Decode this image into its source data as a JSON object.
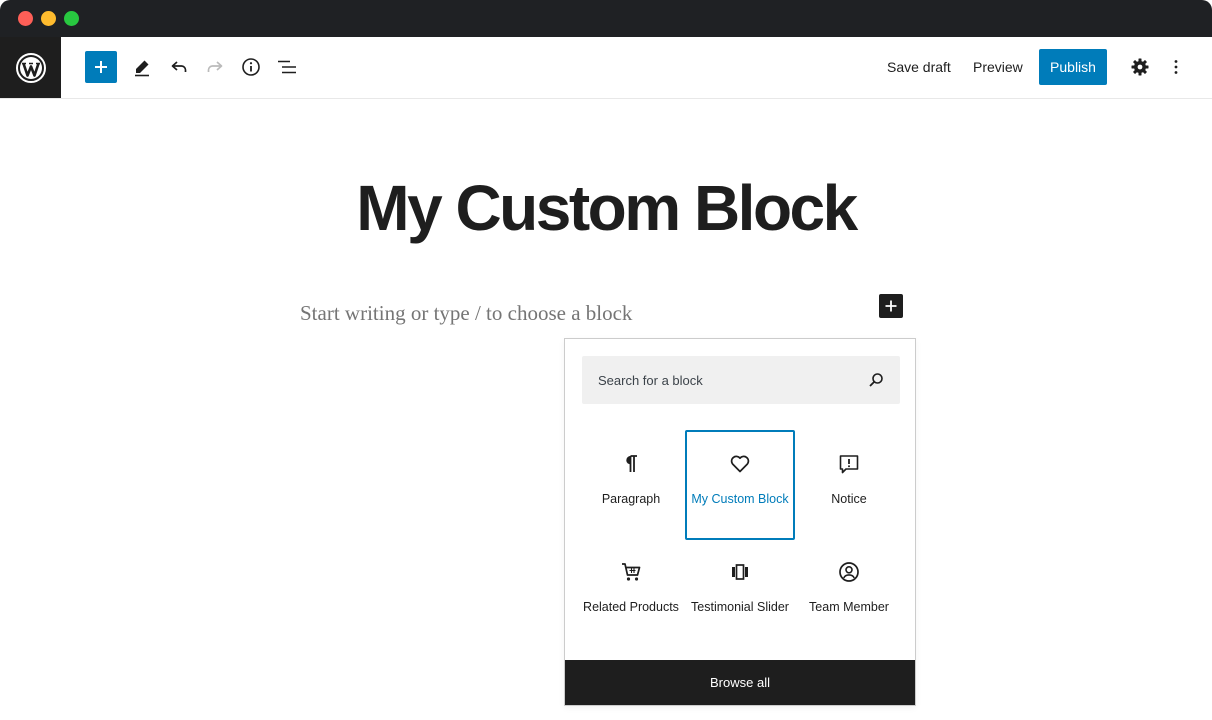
{
  "toolbar": {
    "save_draft_label": "Save draft",
    "preview_label": "Preview",
    "publish_label": "Publish",
    "icons": [
      "wordpress-logo",
      "plus",
      "pencil",
      "undo",
      "redo",
      "info",
      "list-view",
      "gear",
      "more-vertical"
    ]
  },
  "editor": {
    "title": "My Custom Block",
    "placeholder": "Start writing or type / to choose a block"
  },
  "inserter": {
    "search_placeholder": "Search for a block",
    "blocks": [
      {
        "label": "Paragraph",
        "icon": "paragraph-icon",
        "selected": false
      },
      {
        "label": "My Custom Block",
        "icon": "heart-icon",
        "selected": true
      },
      {
        "label": "Notice",
        "icon": "notice-icon",
        "selected": false
      },
      {
        "label": "Related Products",
        "icon": "cart-icon",
        "selected": false
      },
      {
        "label": "Testimonial Slider",
        "icon": "slider-icon",
        "selected": false
      },
      {
        "label": "Team Member",
        "icon": "user-circle-icon",
        "selected": false
      }
    ],
    "browse_all_label": "Browse all"
  },
  "colors": {
    "accent": "#007cba",
    "dark": "#1e1e1e",
    "titlebar": "#1f2124"
  }
}
